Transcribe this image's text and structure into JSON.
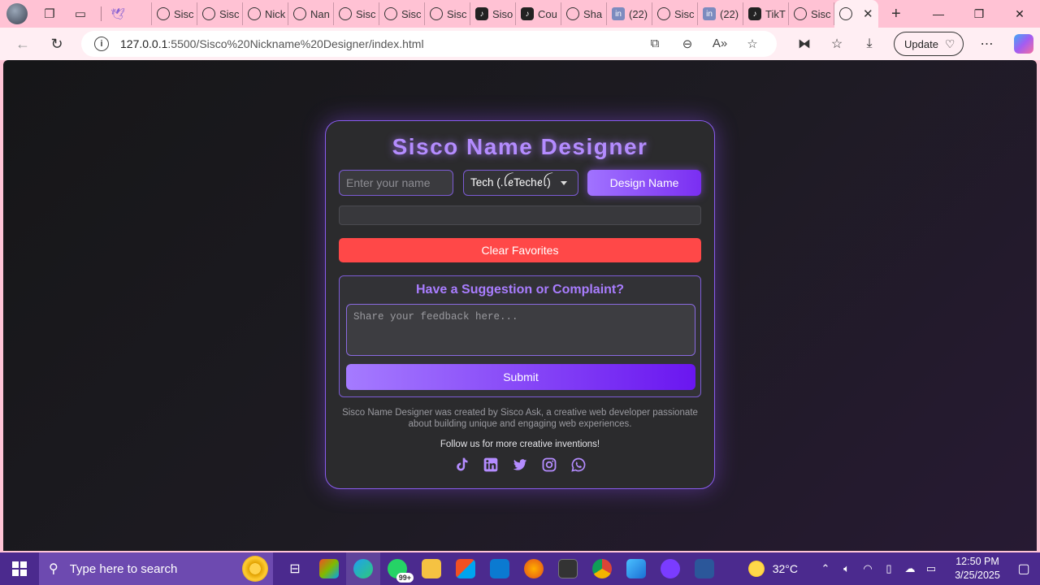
{
  "browser": {
    "tabs": [
      {
        "label": "",
        "icon": "bird-icon"
      },
      {
        "label": "Sisc",
        "icon": "globe-icon"
      },
      {
        "label": "Sisc",
        "icon": "globe-icon"
      },
      {
        "label": "Nick",
        "icon": "globe-icon"
      },
      {
        "label": "Nan",
        "icon": "globe-icon"
      },
      {
        "label": "Sisc",
        "icon": "globe-icon"
      },
      {
        "label": "Sisc",
        "icon": "globe-icon"
      },
      {
        "label": "Sisc",
        "icon": "globe-icon"
      },
      {
        "label": "Siso",
        "icon": "tiktok-icon"
      },
      {
        "label": "Cou",
        "icon": "tiktok-icon"
      },
      {
        "label": "Sha",
        "icon": "globe-icon"
      },
      {
        "label": "(22)",
        "icon": "linkedin-icon"
      },
      {
        "label": "Sisc",
        "icon": "globe-icon"
      },
      {
        "label": "(22)",
        "icon": "linkedin-icon"
      },
      {
        "label": "TikT",
        "icon": "tiktok-icon"
      },
      {
        "label": "Sisc",
        "icon": "globe-icon"
      }
    ],
    "url_host": "127.0.0.1",
    "url_path": ":5500/Sisco%20Nickname%20Designer/index.html",
    "update_label": "Update"
  },
  "app": {
    "title": "Sisco Name Designer",
    "name_placeholder": "Enter your name",
    "style_selected": "Tech (.ꪶꫀTechꫀꪶ)",
    "design_button": "Design Name",
    "clear_button": "Clear Favorites",
    "feedback_title": "Have a Suggestion or Complaint?",
    "feedback_placeholder": "Share your feedback here...",
    "submit_button": "Submit",
    "about_text": "Sisco Name Designer was created by Sisco Ask, a creative web developer passionate about building unique and engaging web experiences.",
    "follow_text": "Follow us for more creative inventions!",
    "accent_color": "#a97dff",
    "danger_color": "#ff4848"
  },
  "taskbar": {
    "search_placeholder": "Type here to search",
    "whatsapp_badge": "99+",
    "temperature": "32°C",
    "time": "12:50 PM",
    "date": "3/25/2025"
  }
}
